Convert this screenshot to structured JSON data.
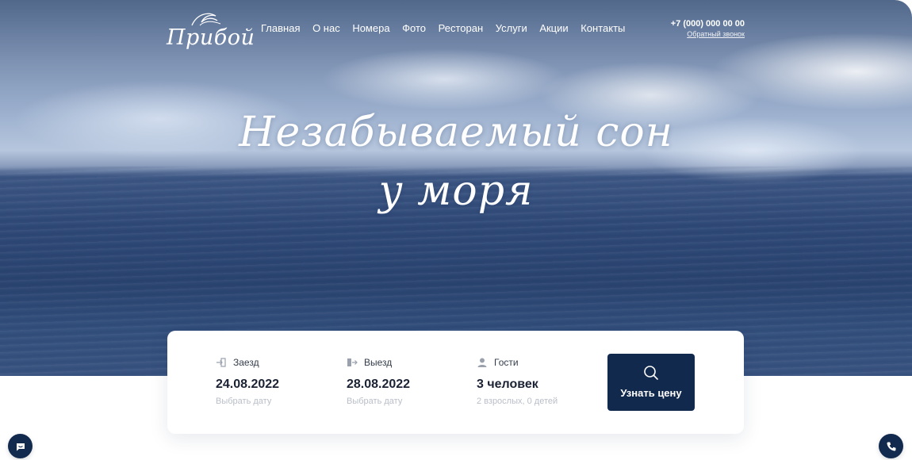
{
  "header": {
    "logo_text": "Прибой",
    "nav": [
      "Главная",
      "О нас",
      "Номера",
      "Фото",
      "Ресторан",
      "Услуги",
      "Акции",
      "Контакты"
    ],
    "phone": "+7 (000) 000 00 00",
    "callback_label": "Обратный звонок"
  },
  "hero": {
    "headline_line1": "Незабываемый сон",
    "headline_line2": "у моря"
  },
  "booking": {
    "checkin": {
      "label": "Заезд",
      "value": "24.08.2022",
      "hint": "Выбрать дату",
      "icon": "door-enter-icon"
    },
    "checkout": {
      "label": "Выезд",
      "value": "28.08.2022",
      "hint": "Выбрать дату",
      "icon": "door-exit-icon"
    },
    "guests": {
      "label": "Гости",
      "value": "3 человек",
      "hint": "2 взрослых, 0 детей",
      "icon": "user-icon"
    },
    "submit_label": "Узнать цену"
  },
  "floating": {
    "left_icon": "chat-icon",
    "right_icon": "phone-icon"
  },
  "colors": {
    "primary": "#12294e",
    "hint_text": "#b9bec8",
    "value_text": "#1b2233"
  }
}
